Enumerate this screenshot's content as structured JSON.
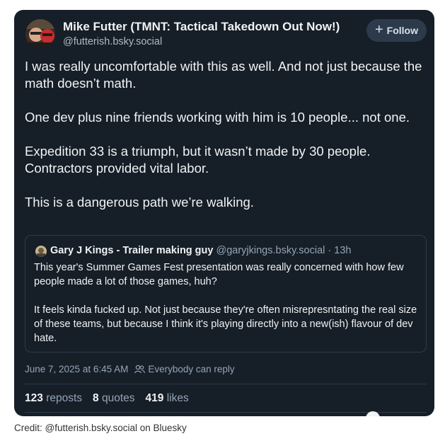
{
  "post": {
    "author": {
      "name": "Mike Futter (TMNT: Tactical Takedown Out Now!)",
      "handle": "@futterish.bsky.social",
      "avatar_icon": "user-avatar-icon"
    },
    "follow_label": "Follow",
    "body": [
      "I was really uncomfortable with this as well. And not just because the math doesn’t math.",
      "One dev plus nine friends working with him is 10 people... not one.",
      "Expedition 33 is a triumph, but it wasn’t made by 30 people. Contractors provided vital labor.",
      "This is a dangerous path we’re walking."
    ],
    "quote": {
      "name": "Gary J Kings - Trailer making guy",
      "handle": "@garyjkings.bsky.social",
      "time": "· 13h",
      "body": [
        "This year's Summer Games Fest presentation was really concerned with how few people made a lot of those games, huh?",
        "It feels kinda fucked up. Not just because they're often misrepresntating the real size of these teams, but because I think it's playing directly into a new(ish) flavour of dev hate."
      ]
    },
    "timestamp": "June 7, 2025 at 6:45 AM",
    "reply_setting": "Everybody can reply",
    "stats": {
      "reposts_count": "123",
      "reposts_label": "reposts",
      "quotes_count": "8",
      "quotes_label": "quotes",
      "likes_count": "419",
      "likes_label": "likes"
    }
  },
  "credit": "Credit: @futterish.bsky.social on Bluesky",
  "colors": {
    "card_bg": "#161e27",
    "text": "#f1f3f5",
    "muted": "#93a5b7",
    "follow_bg": "#2c3a4b"
  }
}
